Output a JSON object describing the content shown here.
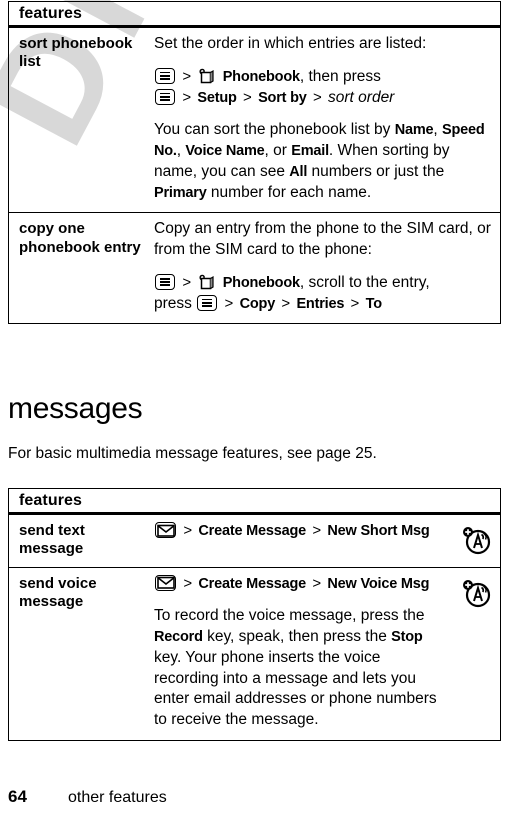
{
  "watermark": {
    "text": "DRAFT"
  },
  "tables": [
    {
      "id": "table-phonebook",
      "header": "features",
      "rows": [
        {
          "feature": "sort phonebook list",
          "paragraphs": [
            {
              "type": "text",
              "text": "Set the order in which entries are listed:"
            },
            {
              "type": "path",
              "lines": [
                {
                  "segments": [
                    {
                      "kind": "icon",
                      "icon": "menu-icon"
                    },
                    {
                      "kind": "sep",
                      "text": ">"
                    },
                    {
                      "kind": "icon",
                      "icon": "phonebook-icon"
                    },
                    {
                      "kind": "bold",
                      "text": "Phonebook"
                    },
                    {
                      "kind": "plain",
                      "text": ", then press"
                    }
                  ]
                },
                {
                  "segments": [
                    {
                      "kind": "icon",
                      "icon": "menu-icon"
                    },
                    {
                      "kind": "sep",
                      "text": ">"
                    },
                    {
                      "kind": "bold",
                      "text": "Setup"
                    },
                    {
                      "kind": "sep",
                      "text": ">"
                    },
                    {
                      "kind": "bold",
                      "text": "Sort by"
                    },
                    {
                      "kind": "sep",
                      "text": ">"
                    },
                    {
                      "kind": "italic",
                      "text": "sort order"
                    }
                  ]
                }
              ]
            },
            {
              "type": "rich",
              "segments": [
                {
                  "kind": "plain",
                  "text": "You can sort the phonebook list by "
                },
                {
                  "kind": "bold",
                  "text": "Name"
                },
                {
                  "kind": "plain",
                  "text": ", "
                },
                {
                  "kind": "bold",
                  "text": "Speed No."
                },
                {
                  "kind": "plain",
                  "text": ", "
                },
                {
                  "kind": "bold",
                  "text": "Voice Name"
                },
                {
                  "kind": "plain",
                  "text": ", or "
                },
                {
                  "kind": "bold",
                  "text": "Email"
                },
                {
                  "kind": "plain",
                  "text": ". When sorting by name, you can see "
                },
                {
                  "kind": "bold",
                  "text": "All"
                },
                {
                  "kind": "plain",
                  "text": " numbers or just the "
                },
                {
                  "kind": "bold",
                  "text": "Primary"
                },
                {
                  "kind": "plain",
                  "text": " number for each name."
                }
              ]
            }
          ],
          "trailing_icon": null
        },
        {
          "feature": "copy one phonebook entry",
          "paragraphs": [
            {
              "type": "text",
              "text": "Copy an entry from the phone to the SIM card, or from the SIM card to the phone:"
            },
            {
              "type": "path",
              "lines": [
                {
                  "segments": [
                    {
                      "kind": "icon",
                      "icon": "menu-icon"
                    },
                    {
                      "kind": "sep",
                      "text": ">"
                    },
                    {
                      "kind": "icon",
                      "icon": "phonebook-icon"
                    },
                    {
                      "kind": "bold",
                      "text": "Phonebook"
                    },
                    {
                      "kind": "plain",
                      "text": ", scroll to the entry,"
                    }
                  ]
                },
                {
                  "segments": [
                    {
                      "kind": "plain",
                      "text": "press "
                    },
                    {
                      "kind": "icon",
                      "icon": "menu-icon"
                    },
                    {
                      "kind": "sep",
                      "text": ">"
                    },
                    {
                      "kind": "bold",
                      "text": "Copy"
                    },
                    {
                      "kind": "sep",
                      "text": ">"
                    },
                    {
                      "kind": "bold",
                      "text": "Entries"
                    },
                    {
                      "kind": "sep",
                      "text": ">"
                    },
                    {
                      "kind": "bold",
                      "text": "To"
                    }
                  ]
                }
              ]
            }
          ],
          "trailing_icon": null
        }
      ]
    },
    {
      "id": "table-messages",
      "header": "features",
      "rows": [
        {
          "feature": "send text message",
          "paragraphs": [
            {
              "type": "path",
              "lines": [
                {
                  "segments": [
                    {
                      "kind": "icon",
                      "icon": "envelope-icon"
                    },
                    {
                      "kind": "sep",
                      "text": ">"
                    },
                    {
                      "kind": "bold",
                      "text": "Create Message"
                    },
                    {
                      "kind": "sep",
                      "text": ">"
                    },
                    {
                      "kind": "bold",
                      "text": "New Short Msg"
                    }
                  ]
                }
              ]
            }
          ],
          "trailing_icon": "network-feature-icon"
        },
        {
          "feature": "send voice message",
          "paragraphs": [
            {
              "type": "path",
              "lines": [
                {
                  "segments": [
                    {
                      "kind": "icon",
                      "icon": "envelope-icon"
                    },
                    {
                      "kind": "sep",
                      "text": ">"
                    },
                    {
                      "kind": "bold",
                      "text": "Create Message"
                    },
                    {
                      "kind": "sep",
                      "text": ">"
                    },
                    {
                      "kind": "bold",
                      "text": "New Voice Msg"
                    }
                  ]
                }
              ]
            },
            {
              "type": "rich",
              "segments": [
                {
                  "kind": "plain",
                  "text": "To record the voice message, press the "
                },
                {
                  "kind": "bold",
                  "text": "Record"
                },
                {
                  "kind": "plain",
                  "text": " key, speak, then press the "
                },
                {
                  "kind": "bold",
                  "text": "Stop"
                },
                {
                  "kind": "plain",
                  "text": " key. Your phone inserts the voice recording into a message and lets you enter email addresses or phone numbers to receive the message."
                }
              ]
            }
          ],
          "trailing_icon": "network-feature-icon"
        }
      ]
    }
  ],
  "section": {
    "heading": "messages",
    "intro": "For basic multimedia message features, see page 25."
  },
  "footer": {
    "page_number": "64",
    "title": "other features"
  },
  "colors": {
    "text": "#000000",
    "background": "#ffffff",
    "watermark": "#d8d8d8",
    "rule": "#000000"
  }
}
